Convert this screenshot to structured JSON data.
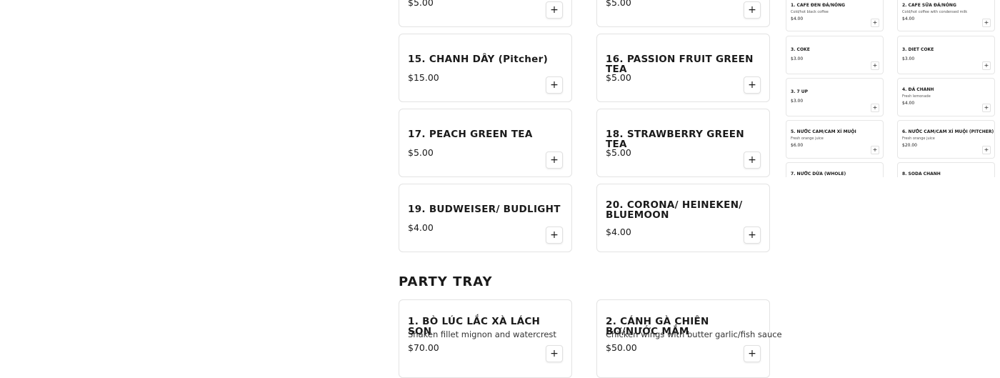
{
  "drinks_cards": [
    {
      "name": "",
      "price": "$5.00"
    },
    {
      "name": "",
      "price": "$5.00"
    },
    {
      "name": "15. CHANH DÂY (Pitcher)",
      "price": "$15.00"
    },
    {
      "name": "16. PASSION FRUIT GREEN TEA",
      "price": "$5.00"
    },
    {
      "name": "17. PEACH GREEN TEA",
      "price": "$5.00"
    },
    {
      "name": "18. STRAWBERRY GREEN TEA",
      "price": "$5.00"
    },
    {
      "name": "19. BUDWEISER/ BUDLIGHT",
      "price": "$4.00"
    },
    {
      "name": "20. CORONA/ HEINEKEN/ BLUEMOON",
      "price": "$4.00"
    }
  ],
  "party_tray": {
    "title": "PARTY TRAY",
    "items": [
      {
        "name": "1. BÒ LÚC LẮC XÀ LÁCH SON",
        "desc": "Shaken fillet mignon and watercrest",
        "price": "$70.00"
      },
      {
        "name": "2. CÁNH GÀ CHIÊN BƠ/NƯỚC MẮM",
        "desc": "Chicken wings with butter garlic/fish sauce",
        "price": "$50.00"
      }
    ]
  },
  "add_button_label": "+",
  "mini_items": [
    {
      "name": "1. CAFE ĐEN ĐÁ/NÓNG",
      "desc": "Cold/hot black coffee",
      "price": "$4.00"
    },
    {
      "name": "2. CAFE SỮA ĐÁ/NÓNG",
      "desc": "Cold/hot coffee with condensed milk",
      "price": "$4.00"
    },
    {
      "name": "3. COKE",
      "desc": "",
      "price": "$3.00"
    },
    {
      "name": "3. DIET COKE",
      "desc": "",
      "price": "$3.00"
    },
    {
      "name": "3. 7 UP",
      "desc": "",
      "price": "$3.00"
    },
    {
      "name": "4. ĐÁ CHANH",
      "desc": "Fresh lemonade",
      "price": "$4.00"
    },
    {
      "name": "5. NƯỚC CAM/CAM XÍ MUỘI",
      "desc": "Fresh orange juice",
      "price": "$6.00"
    },
    {
      "name": "6. NƯỚC CAM/CAM XÍ MUỘI (Pitcher)",
      "desc": "Fresh orange juice",
      "price": "$20.00"
    },
    {
      "name": "7. NƯỚC DỪA (whole)",
      "desc": "",
      "price": ""
    },
    {
      "name": "8. SODA CHANH",
      "desc": "",
      "price": ""
    }
  ]
}
